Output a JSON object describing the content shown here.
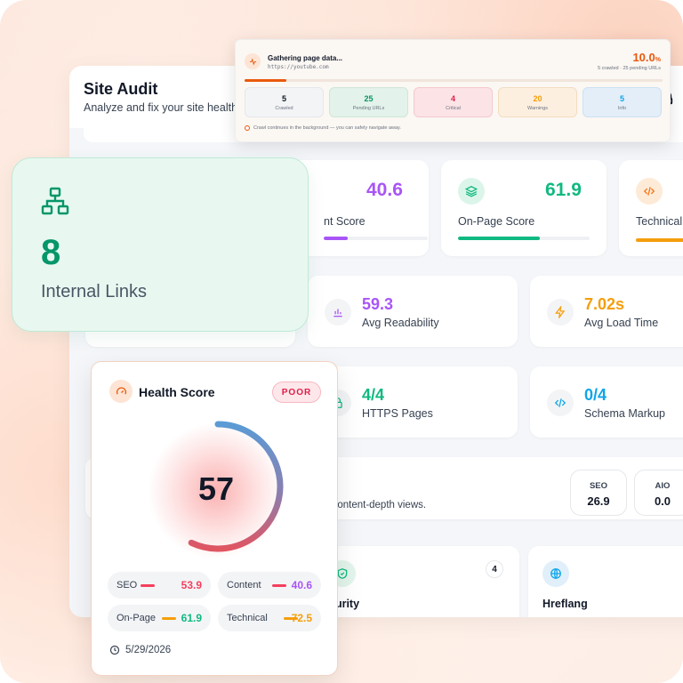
{
  "header": {
    "title": "Site Audit",
    "subtitle": "Analyze and fix your site health"
  },
  "scores": [
    {
      "label": "nt Score",
      "value": "40.6",
      "color": "#a855f7",
      "fill": 0.406
    },
    {
      "label": "On-Page Score",
      "value": "61.9",
      "color": "#10b981",
      "fill": 0.619
    },
    {
      "label": "Technical",
      "value": "",
      "color": "#f59e0b",
      "fill": 0.725
    }
  ],
  "stats": [
    {
      "value": "59.3",
      "label": "Avg Readability",
      "color": "#a855f7",
      "icon": "bar-chart-icon"
    },
    {
      "value": "7.02s",
      "label": "Avg Load Time",
      "color": "#f59e0b",
      "icon": "bolt-icon"
    },
    {
      "value": "4/4",
      "label": "HTTPS Pages",
      "color": "#10b981",
      "icon": "lock-icon"
    },
    {
      "value": "0/4",
      "label": "Schema Markup",
      "color": "#0ea5e9",
      "icon": "code-icon"
    }
  ],
  "views": {
    "text": "d content-depth views.",
    "mini": [
      {
        "label": "SEO",
        "value": "26.9"
      },
      {
        "label": "AIO",
        "value": "0.0"
      }
    ]
  },
  "sections": [
    {
      "label": "curity",
      "count": "4",
      "icon": "shield-check-icon"
    },
    {
      "label": "Hreflang",
      "icon": "globe-icon"
    }
  ],
  "crawl": {
    "title": "Gathering page data...",
    "url": "https://youtube.com",
    "percent": "10.0",
    "percent_unit": "%",
    "progress": 0.1,
    "meta": "5 crawled · 25 pending URLs",
    "boxes": [
      {
        "value": "5",
        "label": "Crawled",
        "color": "#111827",
        "bg": "#f3f4f6",
        "border": "#e5e7eb"
      },
      {
        "value": "25",
        "label": "Pending URLs",
        "color": "#059669",
        "bg": "#e3f2ea",
        "border": "#cfe6d8"
      },
      {
        "value": "4",
        "label": "Critical",
        "color": "#e11d48",
        "bg": "#fbe3e6",
        "border": "#f4c9cf"
      },
      {
        "value": "20",
        "label": "Warnings",
        "color": "#f59e0b",
        "bg": "#fcefe0",
        "border": "#f3dcc0"
      },
      {
        "value": "5",
        "label": "Info",
        "color": "#0ea5e9",
        "bg": "#e3eef9",
        "border": "#cbe1f3"
      }
    ],
    "note": "Crawl continues in the background — you can safely navigate away."
  },
  "internal_links": {
    "value": "8",
    "label": "Internal Links",
    "icon": "sitemap-icon"
  },
  "health": {
    "title": "Health Score",
    "badge": "POOR",
    "score": "57",
    "score_fraction": 0.57,
    "metrics": [
      {
        "label": "SEO",
        "value": "53.9",
        "color": "#f43f5e",
        "bar": "#f43f5e"
      },
      {
        "label": "Content",
        "value": "40.6",
        "color": "#a855f7",
        "bar": "#f43f5e"
      },
      {
        "label": "On-Page",
        "value": "61.9",
        "color": "#10b981",
        "bar": "#f59e0b"
      },
      {
        "label": "Technical",
        "value": "72.5",
        "color": "#f59e0b",
        "bar": "#f59e0b"
      }
    ],
    "date": "5/29/2026"
  }
}
